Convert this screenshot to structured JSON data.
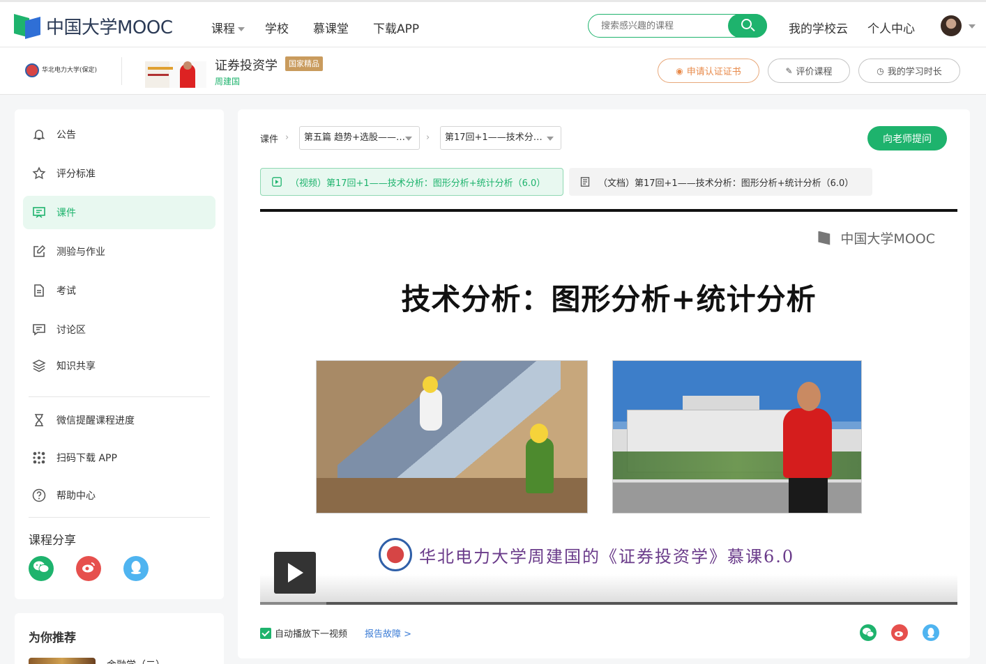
{
  "nav": {
    "logo_text": "中国大学MOOC",
    "links": [
      "课程",
      "学校",
      "慕课堂",
      "下载APP"
    ],
    "search_placeholder": "搜索感兴趣的课程",
    "right_links": [
      "我的学校云",
      "个人中心"
    ]
  },
  "course": {
    "school_name": "华北电力大学(保定)",
    "title": "证券投资学",
    "badge": "国家精品",
    "teacher": "周建国",
    "buttons": {
      "cert": "申请认证证书",
      "rate": "评价课程",
      "time": "我的学习时长"
    }
  },
  "sidebar": {
    "items": [
      {
        "label": "公告",
        "icon": "bell-icon"
      },
      {
        "label": "评分标准",
        "icon": "star-icon"
      },
      {
        "label": "课件",
        "icon": "courseware-icon",
        "active": true
      },
      {
        "label": "测验与作业",
        "icon": "edit-icon"
      },
      {
        "label": "考试",
        "icon": "document-icon"
      },
      {
        "label": "讨论区",
        "icon": "discussion-icon"
      },
      {
        "label": "知识共享",
        "icon": "layers-icon"
      }
    ],
    "extra": [
      {
        "label": "微信提醒课程进度",
        "icon": "hourglass-icon"
      },
      {
        "label": "扫码下载 APP",
        "icon": "qrcode-icon"
      },
      {
        "label": "帮助中心",
        "icon": "help-icon"
      }
    ],
    "share_title": "课程分享",
    "recommend_title": "为你推荐",
    "recommend_item": "金融学（二）"
  },
  "main": {
    "crumb_label": "课件",
    "chapter_select": "第五篇 趋势+选股——…",
    "lesson_select": "第17回+1——技术分…",
    "ask_button": "向老师提问",
    "video_tab": "（视频）第17回+1——技术分析：图形分析+统计分析（6.0）",
    "doc_tab": "（文档）第17回+1——技术分析：图形分析+统计分析（6.0）",
    "player": {
      "watermark": "中国大学MOOC",
      "slide_title": "技术分析：图形分析+统计分析",
      "slide_footer": "华北电力大学周建国的《证券投资学》慕课6.0",
      "progress": 0.095
    },
    "autoplay_label": "自动播放下一视频",
    "report_link": "报告故障 >"
  },
  "colors": {
    "accent": "#1eb36d",
    "wechat": "#1eb36d",
    "weibo": "#e6504d",
    "qq": "#4fb4f0",
    "link": "#3a7bd5"
  }
}
